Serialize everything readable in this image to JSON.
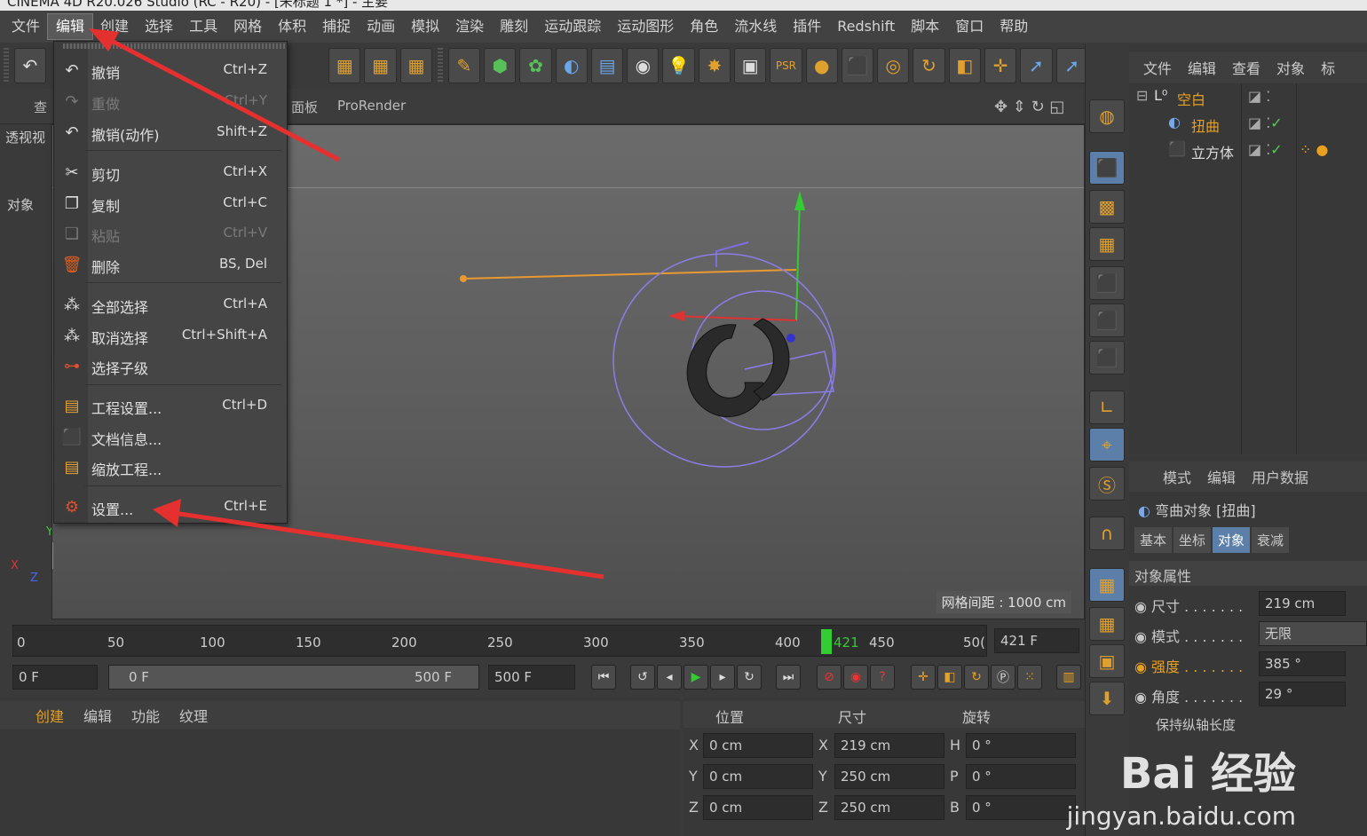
{
  "window": {
    "title": "CINEMA 4D R20.026 Studio (RC - R20) - [未标题 1 *] - 主要"
  },
  "menubar": [
    "文件",
    "编辑",
    "创建",
    "选择",
    "工具",
    "网格",
    "体积",
    "捕捉",
    "动画",
    "模拟",
    "渲染",
    "雕刻",
    "运动跟踪",
    "运动图形",
    "角色",
    "流水线",
    "插件",
    "Redshift",
    "脚本",
    "窗口",
    "帮助"
  ],
  "edit_menu": {
    "items": [
      {
        "label": "撤销",
        "shortcut": "Ctrl+Z",
        "disabled": false,
        "icon": "undo-icon"
      },
      {
        "label": "重做",
        "shortcut": "Ctrl+Y",
        "disabled": true,
        "icon": "redo-icon"
      },
      {
        "label": "撤销(动作)",
        "shortcut": "Shift+Z",
        "disabled": false,
        "icon": "undo-action-icon"
      },
      {
        "label": "剪切",
        "shortcut": "Ctrl+X",
        "disabled": false,
        "icon": "scissors-icon"
      },
      {
        "label": "复制",
        "shortcut": "Ctrl+C",
        "disabled": false,
        "icon": "copy-icon"
      },
      {
        "label": "粘贴",
        "shortcut": "Ctrl+V",
        "disabled": true,
        "icon": "paste-icon"
      },
      {
        "label": "删除",
        "shortcut": "BS, Del",
        "disabled": false,
        "icon": "trash-icon"
      },
      {
        "label": "全部选择",
        "shortcut": "Ctrl+A",
        "disabled": false,
        "icon": "select-all-icon"
      },
      {
        "label": "取消选择",
        "shortcut": "Ctrl+Shift+A",
        "disabled": false,
        "icon": "deselect-icon"
      },
      {
        "label": "选择子级",
        "shortcut": "",
        "disabled": false,
        "icon": "select-children-icon"
      },
      {
        "label": "工程设置...",
        "shortcut": "Ctrl+D",
        "disabled": false,
        "icon": "project-settings-icon"
      },
      {
        "label": "文档信息...",
        "shortcut": "",
        "disabled": false,
        "icon": "document-info-icon"
      },
      {
        "label": "缩放工程...",
        "shortcut": "",
        "disabled": false,
        "icon": "scale-project-icon"
      },
      {
        "label": "设置...",
        "shortcut": "Ctrl+E",
        "disabled": false,
        "icon": "preferences-icon"
      }
    ]
  },
  "viewport": {
    "header_left_tab": "查",
    "header_panel": "面板",
    "header_prorender": "ProRender",
    "view_name": "透视视",
    "left_tab": "对象",
    "grid_spacing": "网格间距 : 1000 cm",
    "axis_y": "Y",
    "axis_x": "X",
    "axis_z": "Z"
  },
  "objects": {
    "tabs": [
      "文件",
      "编辑",
      "查看",
      "对象",
      "标"
    ],
    "rows": [
      {
        "name": "空白",
        "icon": "null-icon"
      },
      {
        "name": "扭曲",
        "icon": "twist-deformer-icon"
      },
      {
        "name": "立方体",
        "icon": "cube-icon"
      }
    ]
  },
  "attributes": {
    "tabs": [
      "模式",
      "编辑",
      "用户数据"
    ],
    "object_title": "弯曲对象 [扭曲]",
    "subtabs": [
      "基本",
      "坐标",
      "对象",
      "衰减"
    ],
    "section": "对象属性",
    "fields": [
      {
        "label": "尺寸 . . . . . . .",
        "value": "219 cm"
      },
      {
        "label": "模式 . . . . . . .",
        "value": "无限"
      },
      {
        "label": "强度 . . . . . . .",
        "value": "385 °"
      },
      {
        "label": "角度 . . . . . . .",
        "value": "29 °"
      }
    ],
    "extra_label": "保持纵轴长度"
  },
  "timeline": {
    "ticks": [
      "0",
      "50",
      "100",
      "150",
      "200",
      "250",
      "300",
      "350",
      "400",
      "421",
      "450",
      "50("
    ],
    "current_frame": "421 F",
    "start": "0 F",
    "range_start": "0 F",
    "range_end": "500 F",
    "end": "500 F"
  },
  "bottom": {
    "material_tabs": [
      "创建",
      "编辑",
      "功能",
      "纹理"
    ],
    "coord_headers": [
      "位置",
      "尺寸",
      "旋转"
    ],
    "coords": [
      {
        "axis": "X",
        "pos": "0 cm",
        "size_axis": "X",
        "size": "219 cm",
        "rot_axis": "H",
        "rot": "0 °"
      },
      {
        "axis": "Y",
        "pos": "0 cm",
        "size_axis": "Y",
        "size": "250 cm",
        "rot_axis": "P",
        "rot": "0 °"
      },
      {
        "axis": "Z",
        "pos": "0 cm",
        "size_axis": "Z",
        "size": "250 cm",
        "rot_axis": "B",
        "rot": "0 °"
      }
    ]
  },
  "watermark": {
    "brand": "Bai 经验",
    "url": "jingyan.baidu.com"
  }
}
